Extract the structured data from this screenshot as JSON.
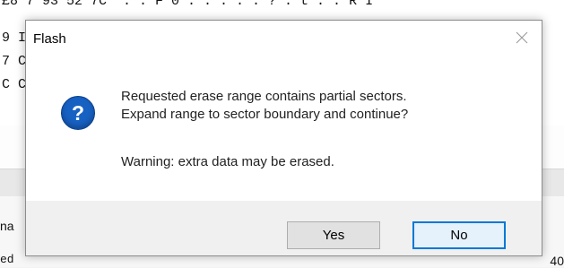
{
  "background": {
    "hex_lines": [
      "£8 7 93 52 7C  . . F 0 . . . . . ? . t . . R I",
      "9 I",
      "7 C",
      "C C"
    ],
    "side_label": "na",
    "bottom_fragment": "ed",
    "trailing_fragment": "40"
  },
  "dialog": {
    "title": "Flash",
    "icon": "question-icon",
    "icon_glyph": "?",
    "message_line1": "Requested erase range contains partial sectors.",
    "message_line2": "Expand range to sector boundary and continue?",
    "warning": "Warning: extra data may be erased.",
    "buttons": {
      "yes": "Yes",
      "no": "No"
    }
  },
  "colors": {
    "accent": "#0078d7",
    "icon_blue": "#1761c3"
  }
}
